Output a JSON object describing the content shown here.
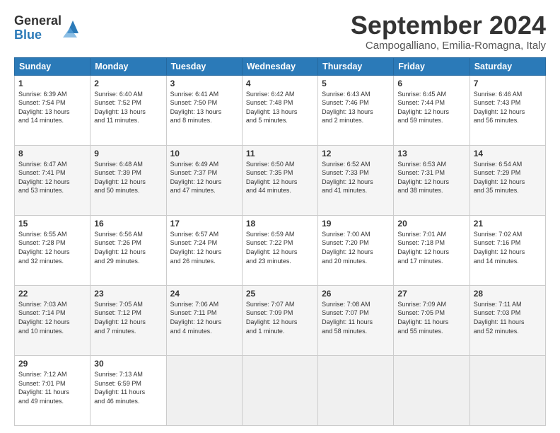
{
  "header": {
    "logo_general": "General",
    "logo_blue": "Blue",
    "month_title": "September 2024",
    "location": "Campogalliano, Emilia-Romagna, Italy"
  },
  "weekdays": [
    "Sunday",
    "Monday",
    "Tuesday",
    "Wednesday",
    "Thursday",
    "Friday",
    "Saturday"
  ],
  "weeks": [
    [
      {
        "day": "1",
        "info": "Sunrise: 6:39 AM\nSunset: 7:54 PM\nDaylight: 13 hours\nand 14 minutes."
      },
      {
        "day": "2",
        "info": "Sunrise: 6:40 AM\nSunset: 7:52 PM\nDaylight: 13 hours\nand 11 minutes."
      },
      {
        "day": "3",
        "info": "Sunrise: 6:41 AM\nSunset: 7:50 PM\nDaylight: 13 hours\nand 8 minutes."
      },
      {
        "day": "4",
        "info": "Sunrise: 6:42 AM\nSunset: 7:48 PM\nDaylight: 13 hours\nand 5 minutes."
      },
      {
        "day": "5",
        "info": "Sunrise: 6:43 AM\nSunset: 7:46 PM\nDaylight: 13 hours\nand 2 minutes."
      },
      {
        "day": "6",
        "info": "Sunrise: 6:45 AM\nSunset: 7:44 PM\nDaylight: 12 hours\nand 59 minutes."
      },
      {
        "day": "7",
        "info": "Sunrise: 6:46 AM\nSunset: 7:43 PM\nDaylight: 12 hours\nand 56 minutes."
      }
    ],
    [
      {
        "day": "8",
        "info": "Sunrise: 6:47 AM\nSunset: 7:41 PM\nDaylight: 12 hours\nand 53 minutes."
      },
      {
        "day": "9",
        "info": "Sunrise: 6:48 AM\nSunset: 7:39 PM\nDaylight: 12 hours\nand 50 minutes."
      },
      {
        "day": "10",
        "info": "Sunrise: 6:49 AM\nSunset: 7:37 PM\nDaylight: 12 hours\nand 47 minutes."
      },
      {
        "day": "11",
        "info": "Sunrise: 6:50 AM\nSunset: 7:35 PM\nDaylight: 12 hours\nand 44 minutes."
      },
      {
        "day": "12",
        "info": "Sunrise: 6:52 AM\nSunset: 7:33 PM\nDaylight: 12 hours\nand 41 minutes."
      },
      {
        "day": "13",
        "info": "Sunrise: 6:53 AM\nSunset: 7:31 PM\nDaylight: 12 hours\nand 38 minutes."
      },
      {
        "day": "14",
        "info": "Sunrise: 6:54 AM\nSunset: 7:29 PM\nDaylight: 12 hours\nand 35 minutes."
      }
    ],
    [
      {
        "day": "15",
        "info": "Sunrise: 6:55 AM\nSunset: 7:28 PM\nDaylight: 12 hours\nand 32 minutes."
      },
      {
        "day": "16",
        "info": "Sunrise: 6:56 AM\nSunset: 7:26 PM\nDaylight: 12 hours\nand 29 minutes."
      },
      {
        "day": "17",
        "info": "Sunrise: 6:57 AM\nSunset: 7:24 PM\nDaylight: 12 hours\nand 26 minutes."
      },
      {
        "day": "18",
        "info": "Sunrise: 6:59 AM\nSunset: 7:22 PM\nDaylight: 12 hours\nand 23 minutes."
      },
      {
        "day": "19",
        "info": "Sunrise: 7:00 AM\nSunset: 7:20 PM\nDaylight: 12 hours\nand 20 minutes."
      },
      {
        "day": "20",
        "info": "Sunrise: 7:01 AM\nSunset: 7:18 PM\nDaylight: 12 hours\nand 17 minutes."
      },
      {
        "day": "21",
        "info": "Sunrise: 7:02 AM\nSunset: 7:16 PM\nDaylight: 12 hours\nand 14 minutes."
      }
    ],
    [
      {
        "day": "22",
        "info": "Sunrise: 7:03 AM\nSunset: 7:14 PM\nDaylight: 12 hours\nand 10 minutes."
      },
      {
        "day": "23",
        "info": "Sunrise: 7:05 AM\nSunset: 7:12 PM\nDaylight: 12 hours\nand 7 minutes."
      },
      {
        "day": "24",
        "info": "Sunrise: 7:06 AM\nSunset: 7:11 PM\nDaylight: 12 hours\nand 4 minutes."
      },
      {
        "day": "25",
        "info": "Sunrise: 7:07 AM\nSunset: 7:09 PM\nDaylight: 12 hours\nand 1 minute."
      },
      {
        "day": "26",
        "info": "Sunrise: 7:08 AM\nSunset: 7:07 PM\nDaylight: 11 hours\nand 58 minutes."
      },
      {
        "day": "27",
        "info": "Sunrise: 7:09 AM\nSunset: 7:05 PM\nDaylight: 11 hours\nand 55 minutes."
      },
      {
        "day": "28",
        "info": "Sunrise: 7:11 AM\nSunset: 7:03 PM\nDaylight: 11 hours\nand 52 minutes."
      }
    ],
    [
      {
        "day": "29",
        "info": "Sunrise: 7:12 AM\nSunset: 7:01 PM\nDaylight: 11 hours\nand 49 minutes."
      },
      {
        "day": "30",
        "info": "Sunrise: 7:13 AM\nSunset: 6:59 PM\nDaylight: 11 hours\nand 46 minutes."
      },
      {
        "day": "",
        "info": ""
      },
      {
        "day": "",
        "info": ""
      },
      {
        "day": "",
        "info": ""
      },
      {
        "day": "",
        "info": ""
      },
      {
        "day": "",
        "info": ""
      }
    ]
  ]
}
